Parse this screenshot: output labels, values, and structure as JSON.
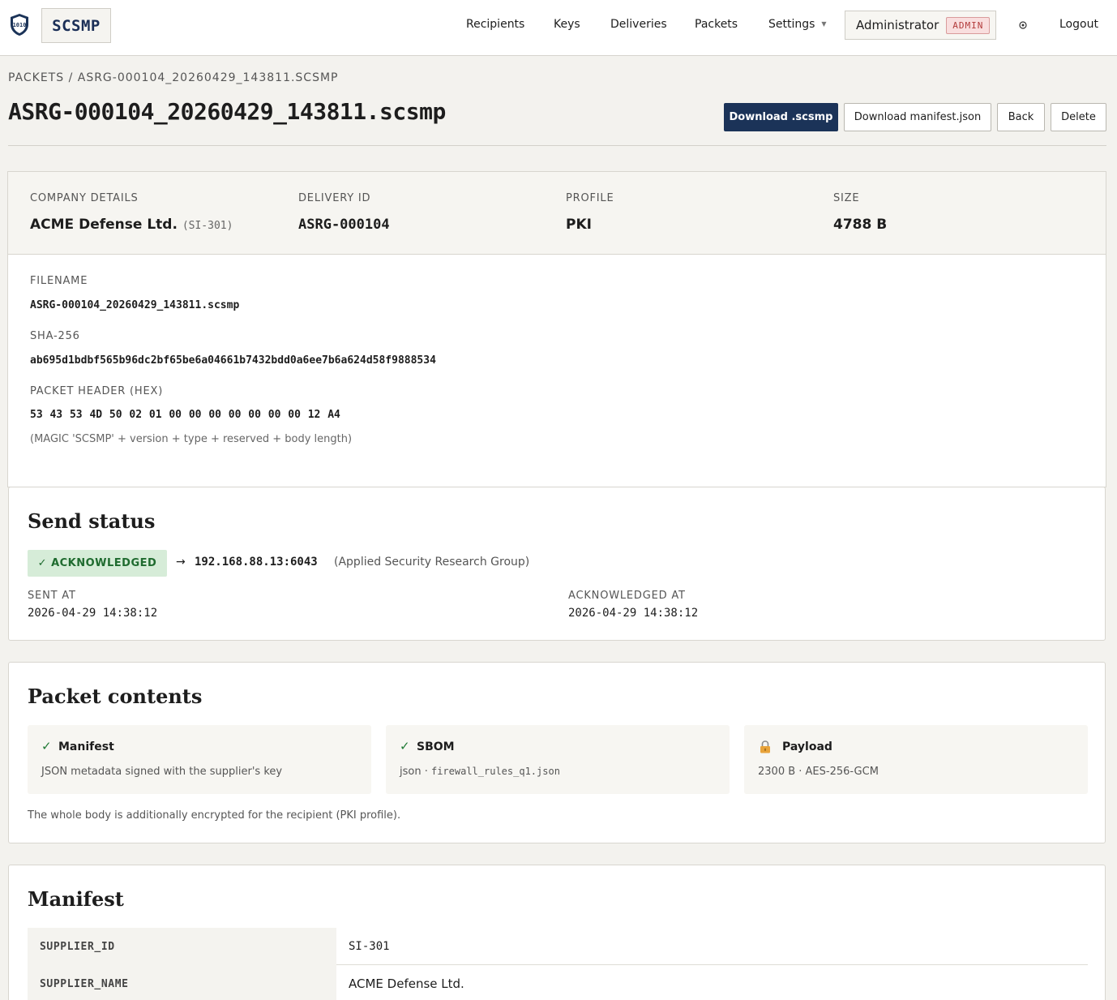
{
  "nav": {
    "brand": "SCSMP",
    "items": [
      "Recipients",
      "Keys",
      "Deliveries",
      "Packets",
      "Settings"
    ],
    "user_name": "Administrator",
    "user_role": "ADMIN",
    "logout": "Logout"
  },
  "breadcrumb": "PACKETS / ASRG-000104_20260429_143811.SCSMP",
  "title": "ASRG-000104_20260429_143811.scsmp",
  "actions": {
    "download_packet": "Download .scsmp",
    "download_manifest": "Download manifest.json",
    "back": "Back",
    "delete": "Delete"
  },
  "summary": {
    "company_label": "COMPANY DETAILS",
    "company_name": "ACME Defense Ltd.",
    "company_id": "(SI-301)",
    "delivery_label": "DELIVERY ID",
    "delivery_id": "ASRG-000104",
    "profile_label": "PROFILE",
    "profile": "PKI",
    "size_label": "SIZE",
    "size": "4788 B"
  },
  "details": {
    "filename_label": "FILENAME",
    "filename": "ASRG-000104_20260429_143811.scsmp",
    "sha_label": "SHA-256",
    "sha": "ab695d1bdbf565b96dc2bf65be6a04661b7432bdd0a6ee7b6a624d58f9888534",
    "header_label": "PACKET HEADER (HEX)",
    "header_hex": "53 43 53 4D 50 02 01 00 00 00 00 00 00 00 12 A4",
    "header_note": "(MAGIC 'SCSMP' + version + type + reserved + body length)"
  },
  "send_status": {
    "title": "Send status",
    "status": "✓ ACKNOWLEDGED",
    "arrow": "→",
    "address": "192.168.88.13:6043",
    "recipient": "(Applied Security Research Group)",
    "sent_label": "SENT AT",
    "sent_at": "2026-04-29 14:38:12",
    "ack_label": "ACKNOWLEDGED AT",
    "ack_at": "2026-04-29 14:38:12"
  },
  "contents": {
    "title": "Packet contents",
    "cards": [
      {
        "icon": "✓",
        "title": "Manifest",
        "desc": "JSON metadata signed with the supplier's key"
      },
      {
        "icon": "✓",
        "title": "SBOM",
        "desc_prefix": "json · ",
        "desc_file": "firewall_rules_q1.json"
      },
      {
        "icon": "lock",
        "title": "Payload",
        "desc": "2300 B · AES-256-GCM"
      }
    ],
    "note": "The whole body is additionally encrypted for the recipient (PKI profile)."
  },
  "manifest": {
    "title": "Manifest",
    "rows": [
      {
        "key": "SUPPLIER_ID",
        "value": "SI-301"
      },
      {
        "key": "SUPPLIER_NAME",
        "value": "ACME Defense Ltd."
      }
    ]
  },
  "colors": {
    "primary": "#1b3358",
    "success_bg": "#d6ecd8",
    "success_fg": "#1f6b2f",
    "admin_bg": "#f9dede",
    "admin_fg": "#b23b3b"
  }
}
